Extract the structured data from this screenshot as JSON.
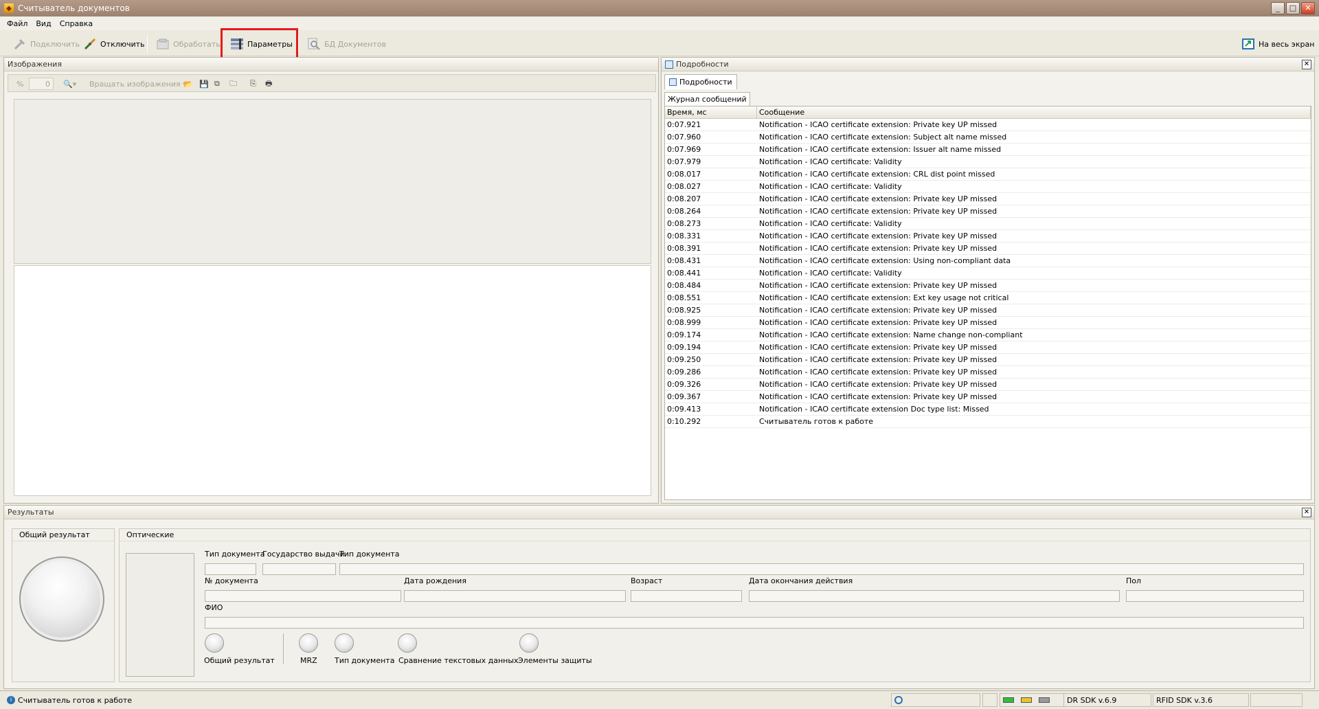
{
  "window": {
    "title": "Считыватель документов"
  },
  "menu": [
    "Файл",
    "Вид",
    "Справка"
  ],
  "toolbar": {
    "connect": "Подключить",
    "disconnect": "Отключить",
    "process": "Обработать",
    "params": "Параметры",
    "doc_db": "БД Документов",
    "fullscreen": "На весь экран"
  },
  "images": {
    "title": "Изображения",
    "zoom_symbol": "%",
    "zoom_value": "0",
    "rotate": "Вращать изображения"
  },
  "details": {
    "title": "Подробности",
    "tab": "Подробности",
    "subtab": "Журнал сообщений",
    "col_time": "Время, мс",
    "col_msg": "Сообщение",
    "rows": [
      [
        "0:07.921",
        "Notification - ICAO certificate extension: Private key UP missed"
      ],
      [
        "0:07.960",
        "Notification - ICAO certificate extension: Subject alt name missed"
      ],
      [
        "0:07.969",
        "Notification - ICAO certificate extension: Issuer alt name missed"
      ],
      [
        "0:07.979",
        "Notification - ICAO certificate: Validity"
      ],
      [
        "0:08.017",
        "Notification - ICAO certificate extension: CRL dist point missed"
      ],
      [
        "0:08.027",
        "Notification - ICAO certificate: Validity"
      ],
      [
        "0:08.207",
        "Notification - ICAO certificate extension: Private key UP missed"
      ],
      [
        "0:08.264",
        "Notification - ICAO certificate extension: Private key UP missed"
      ],
      [
        "0:08.273",
        "Notification - ICAO certificate: Validity"
      ],
      [
        "0:08.331",
        "Notification - ICAO certificate extension: Private key UP missed"
      ],
      [
        "0:08.391",
        "Notification - ICAO certificate extension: Private key UP missed"
      ],
      [
        "0:08.431",
        "Notification - ICAO certificate extension: Using non-compliant data"
      ],
      [
        "0:08.441",
        "Notification - ICAO certificate: Validity"
      ],
      [
        "0:08.484",
        "Notification - ICAO certificate extension: Private key UP missed"
      ],
      [
        "0:08.551",
        "Notification - ICAO certificate extension: Ext key usage not critical"
      ],
      [
        "0:08.925",
        "Notification - ICAO certificate extension: Private key UP missed"
      ],
      [
        "0:08.999",
        "Notification - ICAO certificate extension: Private key UP missed"
      ],
      [
        "0:09.174",
        "Notification - ICAO certificate extension: Name change non-compliant"
      ],
      [
        "0:09.194",
        "Notification - ICAO certificate extension: Private key UP missed"
      ],
      [
        "0:09.250",
        "Notification - ICAO certificate extension: Private key UP missed"
      ],
      [
        "0:09.286",
        "Notification - ICAO certificate extension: Private key UP missed"
      ],
      [
        "0:09.326",
        "Notification - ICAO certificate extension: Private key UP missed"
      ],
      [
        "0:09.367",
        "Notification - ICAO certificate extension: Private key UP missed"
      ],
      [
        "0:09.413",
        "Notification - ICAO certificate extension Doc type list: Missed"
      ],
      [
        "0:10.292",
        "Считыватель готов к работе"
      ]
    ]
  },
  "results": {
    "title": "Результаты",
    "overall_title": "Общий результат",
    "optical_title": "Оптические",
    "labels": {
      "doc_type": "Тип документа",
      "issuing_state": "Государство выдачи",
      "doc_type2": "Тип документа",
      "doc_number": "№ документа",
      "birth_date": "Дата рождения",
      "age": "Возраст",
      "expiry": "Дата окончания действия",
      "sex": "Пол",
      "fio": "ФИО"
    },
    "checks": {
      "overall": "Общий результат",
      "mrz": "MRZ",
      "doc_type": "Тип документа",
      "text_compare": "Сравнение текстовых данных",
      "security": "Элементы защиты"
    }
  },
  "status": {
    "message": "Считыватель готов к работе",
    "dr_sdk": "DR SDK v.6.9",
    "rfid_sdk": "RFID SDK v.3.6"
  },
  "colors": {
    "highlight": "#e21b1b"
  }
}
